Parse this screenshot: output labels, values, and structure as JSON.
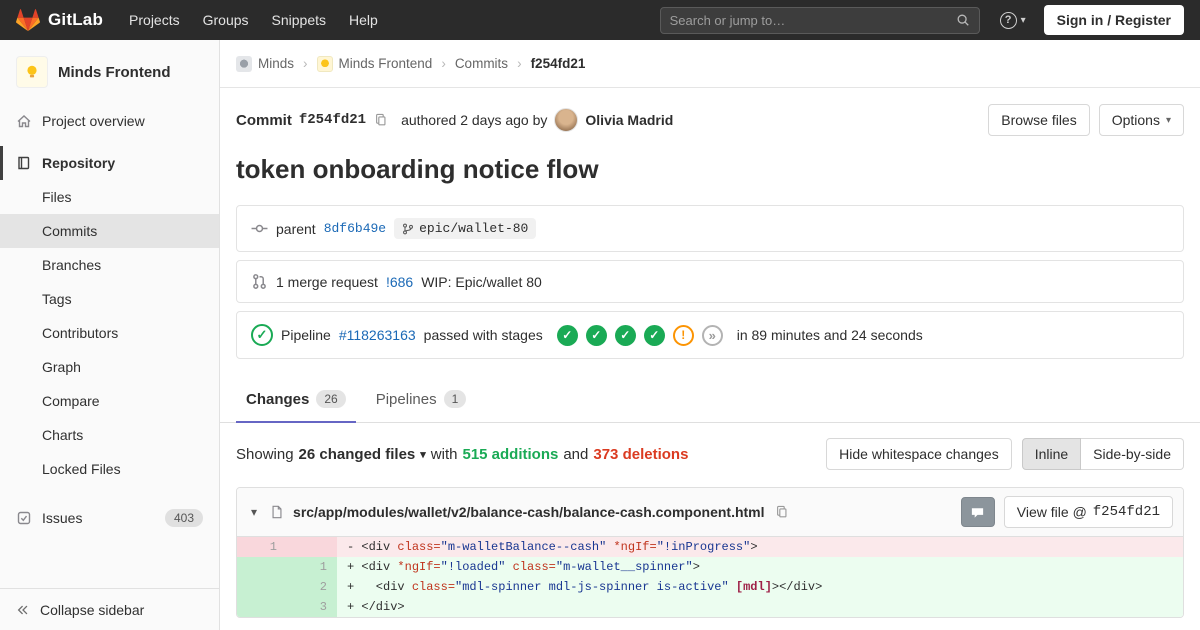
{
  "colors": {
    "navbar_bg": "#2b2b2b",
    "accent": "#6666c4",
    "link": "#1b69b6",
    "green": "#1aaa55",
    "red": "#db3b21",
    "orange": "#fc9403"
  },
  "navbar": {
    "brand": "GitLab",
    "items": [
      "Projects",
      "Groups",
      "Snippets",
      "Help"
    ],
    "search_placeholder": "Search or jump to…",
    "signin_label": "Sign in / Register"
  },
  "sidebar": {
    "project_name": "Minds Frontend",
    "overview_label": "Project overview",
    "repository_label": "Repository",
    "repo_items": [
      "Files",
      "Commits",
      "Branches",
      "Tags",
      "Contributors",
      "Graph",
      "Compare",
      "Charts",
      "Locked Files"
    ],
    "active_repo_item": "Commits",
    "issues_label": "Issues",
    "issues_count": "403",
    "collapse_label": "Collapse sidebar"
  },
  "breadcrumb": {
    "items": [
      "Minds",
      "Minds Frontend",
      "Commits",
      "f254fd21"
    ]
  },
  "commit": {
    "label": "Commit",
    "sha": "f254fd21",
    "authored_text": "authored 2 days ago by",
    "author": "Olivia Madrid",
    "browse_files_label": "Browse files",
    "options_label": "Options",
    "title": "token onboarding notice flow"
  },
  "meta": {
    "parent_label": "parent",
    "parent_sha": "8df6b49e",
    "branch": "epic/wallet-80",
    "mr_count_text": "1 merge request",
    "mr_ref": "!686",
    "mr_title": "WIP: Epic/wallet 80",
    "pipeline_label": "Pipeline",
    "pipeline_id": "#118263163",
    "pipeline_status_text": "passed with stages",
    "stages": [
      "success",
      "success",
      "success",
      "success",
      "warning",
      "skipped"
    ],
    "pipeline_duration": "in 89 minutes and 24 seconds"
  },
  "tabs": [
    {
      "label": "Changes",
      "count": "26",
      "active": true
    },
    {
      "label": "Pipelines",
      "count": "1",
      "active": false
    }
  ],
  "summary": {
    "showing": "Showing",
    "changed_files": "26 changed files",
    "with_text": "with",
    "additions": "515 additions",
    "and_text": "and",
    "deletions": "373 deletions",
    "hide_whitespace_label": "Hide whitespace changes",
    "inline_label": "Inline",
    "side_by_side_label": "Side-by-side"
  },
  "diff": {
    "file_path": "src/app/modules/wallet/v2/balance-cash/balance-cash.component.html",
    "view_file_label": "View file @",
    "view_file_sha": "f254fd21",
    "lines": [
      {
        "old": "1",
        "new": "",
        "type": "del",
        "tokens": [
          {
            "t": "- <div ",
            "c": "p"
          },
          {
            "t": "class=",
            "c": "a"
          },
          {
            "t": "\"m-walletBalance--cash\"",
            "c": "s"
          },
          {
            "t": " ",
            "c": "p"
          },
          {
            "t": "*ngIf=",
            "c": "a"
          },
          {
            "t": "\"!inProgress\"",
            "c": "s"
          },
          {
            "t": ">",
            "c": "p"
          }
        ]
      },
      {
        "old": "",
        "new": "1",
        "type": "add",
        "tokens": [
          {
            "t": "+ <div ",
            "c": "p"
          },
          {
            "t": "*ngIf=",
            "c": "a"
          },
          {
            "t": "\"!loaded\"",
            "c": "s"
          },
          {
            "t": " ",
            "c": "p"
          },
          {
            "t": "class=",
            "c": "a"
          },
          {
            "t": "\"m-wallet__spinner\"",
            "c": "s"
          },
          {
            "t": ">",
            "c": "p"
          }
        ]
      },
      {
        "old": "",
        "new": "2",
        "type": "add",
        "tokens": [
          {
            "t": "+   <div ",
            "c": "p"
          },
          {
            "t": "class=",
            "c": "a"
          },
          {
            "t": "\"mdl-spinner mdl-js-spinner is-active\"",
            "c": "s"
          },
          {
            "t": " ",
            "c": "p"
          },
          {
            "t": "[mdl]",
            "c": "b"
          },
          {
            "t": "></div>",
            "c": "p"
          }
        ]
      },
      {
        "old": "",
        "new": "3",
        "type": "add",
        "tokens": [
          {
            "t": "+ </div>",
            "c": "p"
          }
        ]
      }
    ]
  }
}
